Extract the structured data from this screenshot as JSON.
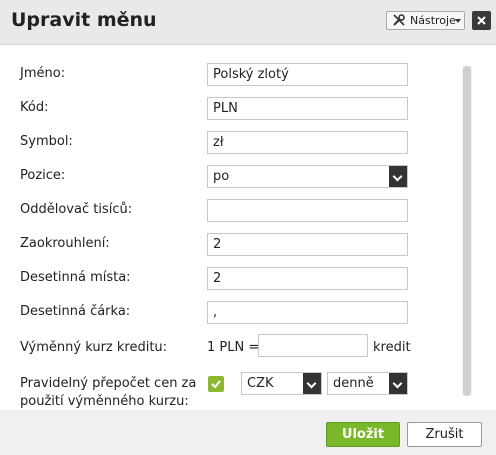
{
  "dialog": {
    "title": "Upravit měnu",
    "tools_label": "Nástroje",
    "close_icon": "close-icon"
  },
  "fields": {
    "name": {
      "label": "Jméno:",
      "value": "Polský zlotý"
    },
    "code": {
      "label": "Kód:",
      "value": "PLN"
    },
    "symbol": {
      "label": "Symbol:",
      "value": "zł"
    },
    "position": {
      "label": "Pozice:",
      "value": "po"
    },
    "thousands_sep": {
      "label": "Oddělovač tisíců:",
      "value": ""
    },
    "rounding": {
      "label": "Zaokrouhlení:",
      "value": "2"
    },
    "decimals": {
      "label": "Desetinná místa:",
      "value": "2"
    },
    "decimal_sep": {
      "label": "Desetinná čárka:",
      "value": ","
    },
    "credit_rate": {
      "label": "Výměnný kurz kreditu:",
      "prefix": "1 PLN =",
      "value": "",
      "suffix": "kredit"
    },
    "auto_convert": {
      "label_line1": "Pravidelný přepočet cen za",
      "label_line2": "použití výměnného kurzu:",
      "checked": true,
      "currency": "CZK",
      "frequency": "denně"
    }
  },
  "footer": {
    "save_label": "Uložit",
    "cancel_label": "Zrušit"
  },
  "colors": {
    "accent_green": "#7ab82b",
    "checkbox_green": "#8db72e"
  }
}
